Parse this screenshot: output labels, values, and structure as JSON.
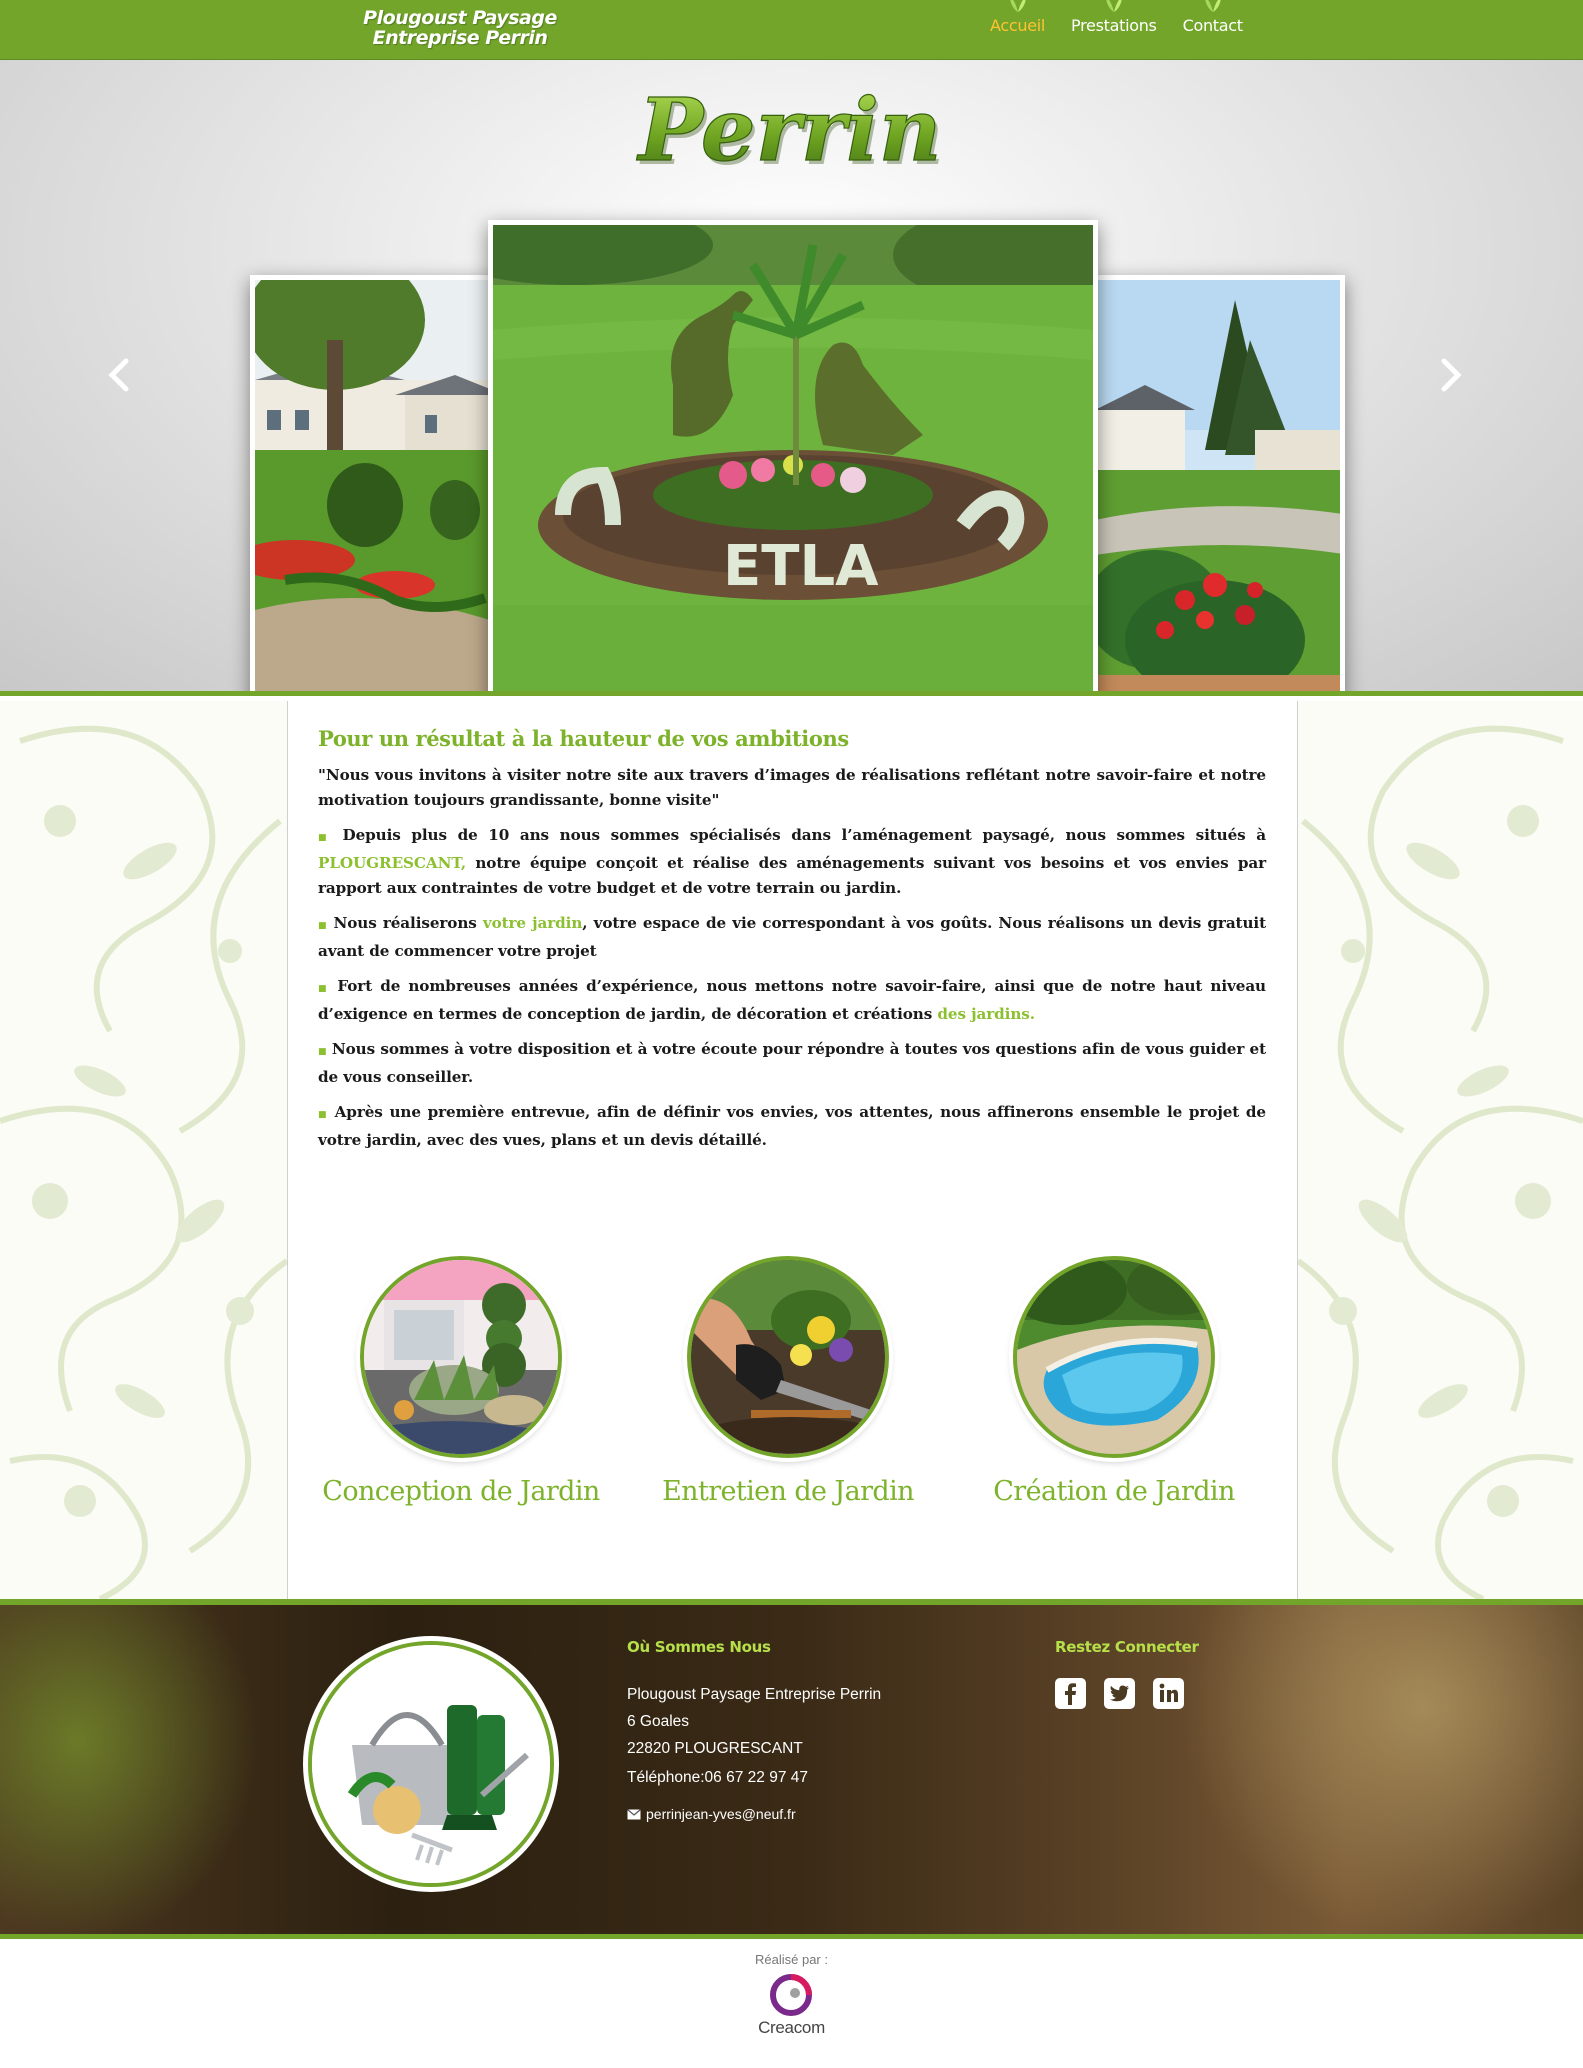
{
  "header": {
    "brand_line1": "Plougoust Paysage",
    "brand_line2": "Entreprise Perrin",
    "nav": [
      {
        "label": "Accueil",
        "active": true
      },
      {
        "label": "Prestations",
        "active": false
      },
      {
        "label": "Contact",
        "active": false
      }
    ]
  },
  "hero": {
    "logo_text": "Perrin",
    "prev_icon": "chevron-left-icon",
    "next_icon": "chevron-right-icon"
  },
  "main": {
    "title": "Pour un résultat à la hauteur de vos ambitions",
    "intro": "\"Nous vous invitons à visiter notre site aux travers d’images de réalisations reflétant notre savoir-faire et notre motivation toujours grandissante, bonne visite\"",
    "p1_a": "Depuis plus de 10 ans nous sommes spécialisés dans l’aménagement paysagé, nous sommes situés à ",
    "p1_city": "PLOUGRESCANT,",
    "p1_b": "  notre équipe  conçoit et réalise des aménagements suivant vos besoins et vos  envies par rapport aux contraintes de votre budget et de votre terrain ou jardin.",
    "p2_a": "Nous  réaliserons ",
    "p2_link": "votre jardin",
    "p2_b": ", votre espace de vie correspondant à vos goûts. Nous réalisons un devis gratuit avant de commencer votre projet",
    "p3_a": "Fort de nombreuses années d’expérience, nous mettons notre savoir-faire, ainsi que de notre haut niveau d’exigence en termes de conception de jardin, de décoration et créations ",
    "p3_link": "des jardins.",
    "p4": "Nous sommes  à votre  disposition et à votre écoute pour répondre à toutes vos questions afin de vous guider et de vous conseiller.",
    "p5": "Après une première entrevue, afin de définir vos envies, vos attentes, nous affinerons ensemble le projet de votre jardin, avec des vues, plans et un devis détaillé.",
    "bullet": "■",
    "services": [
      {
        "label": "Conception de Jardin"
      },
      {
        "label": "Entretien de Jardin"
      },
      {
        "label": "Création de Jardin"
      }
    ]
  },
  "footer": {
    "location_title": "Où Sommes Nous",
    "company": "Plougoust Paysage Entreprise Perrin",
    "street": "6 Goales",
    "city": "22820 PLOUGRESCANT",
    "phone": "Téléphone:06 67 22 97 47",
    "email": "perrinjean-yves@neuf.fr",
    "social_title": "Restez Connecter",
    "social": [
      "facebook-icon",
      "twitter-icon",
      "linkedin-icon"
    ]
  },
  "credits": {
    "label": "Réalisé par :",
    "name": "Creacom"
  },
  "colors": {
    "accent": "#72a52a",
    "text_green": "#8cc031",
    "active_nav": "#ffc233",
    "footer_heading": "#b6e04a"
  }
}
